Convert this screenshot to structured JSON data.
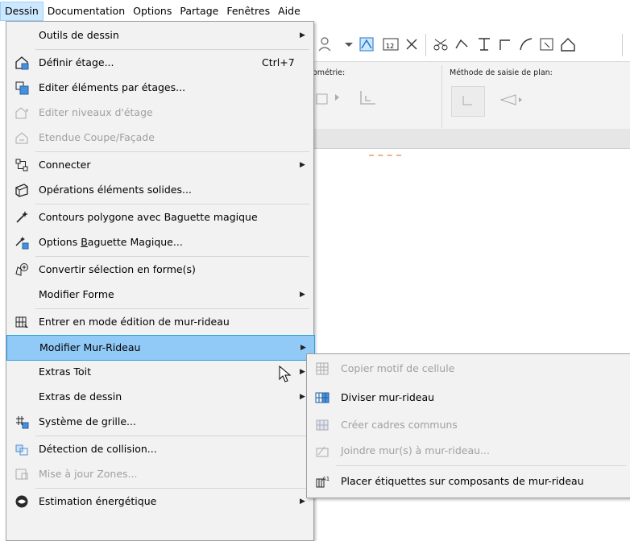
{
  "menubar": {
    "items": [
      "Dessin",
      "Documentation",
      "Options",
      "Partage",
      "Fenêtres",
      "Aide"
    ],
    "active": "Dessin"
  },
  "background": {
    "panel_label_1": "ométrie:",
    "panel_label_2": "Méthode de saisie de plan:"
  },
  "menu": {
    "items": [
      {
        "label": "Outils de dessin",
        "submenu": true,
        "icon": "none"
      },
      {
        "label": "Définir étage...",
        "shortcut": "Ctrl+7",
        "icon": "define-story-icon"
      },
      {
        "label": "Editer éléments par étages...",
        "icon": "edit-by-story-icon"
      },
      {
        "label": "Editer niveaux d'étage",
        "disabled": true,
        "icon": "story-levels-icon"
      },
      {
        "label": "Etendue Coupe/Façade",
        "disabled": true,
        "icon": "section-extent-icon"
      },
      {
        "label": "Connecter",
        "submenu": true,
        "icon": "connect-icon"
      },
      {
        "label": "Opérations éléments solides...",
        "icon": "solid-operations-icon"
      },
      {
        "label": "Contours polygone avec Baguette magique",
        "icon": "magic-wand-icon"
      },
      {
        "label": "Options Baguette Magique...",
        "icon": "magic-wand-options-icon"
      },
      {
        "label": "Convertir sélection en forme(s)",
        "icon": "convert-shape-icon"
      },
      {
        "label": "Modifier Forme",
        "submenu": true,
        "icon": "none"
      },
      {
        "label": "Entrer en mode édition de mur-rideau",
        "icon": "curtain-wall-edit-icon"
      },
      {
        "label": "Modifier Mur-Rideau",
        "submenu": true,
        "highlight": true,
        "icon": "none"
      },
      {
        "label": "Extras Toit",
        "submenu": true,
        "icon": "none"
      },
      {
        "label": "Extras de dessin",
        "submenu": true,
        "icon": "none"
      },
      {
        "label": "Système de grille...",
        "icon": "grid-system-icon"
      },
      {
        "label": "Détection de collision...",
        "icon": "collision-icon"
      },
      {
        "label": "Mise à jour Zones...",
        "disabled": true,
        "icon": "update-zones-icon"
      },
      {
        "label": "Estimation énergétique",
        "submenu": true,
        "icon": "energy-icon"
      }
    ]
  },
  "submenu": {
    "items": [
      {
        "label": "Copier motif de cellule",
        "disabled": true,
        "icon": "copy-pattern-icon"
      },
      {
        "label": "Diviser mur-rideau",
        "icon": "split-curtain-wall-icon"
      },
      {
        "label": "Créer cadres communs",
        "disabled": true,
        "icon": "common-frames-icon"
      },
      {
        "label": "Joindre mur(s) à mur-rideau...",
        "disabled": true,
        "icon": "join-walls-icon"
      },
      {
        "label": "Placer étiquettes sur composants de mur-rideau",
        "icon": "place-labels-icon"
      }
    ]
  },
  "colors": {
    "highlight": "#91c9f7",
    "menu_bg": "#f2f2f2",
    "disabled_text": "#a0a0a0"
  }
}
